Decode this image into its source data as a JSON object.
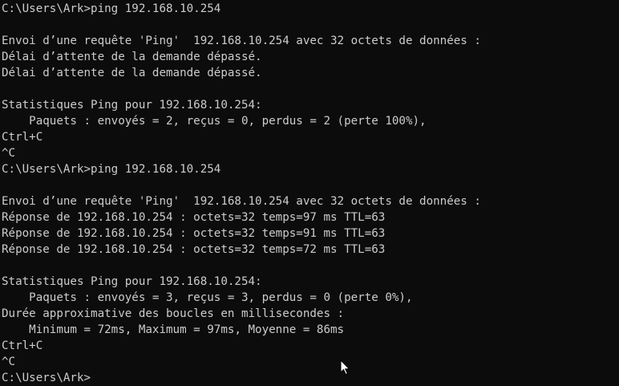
{
  "console": {
    "lines": [
      "C:\\Users\\Ark>ping 192.168.10.254",
      "",
      "Envoi d’une requête 'Ping'  192.168.10.254 avec 32 octets de données :",
      "Délai d’attente de la demande dépassé.",
      "Délai d’attente de la demande dépassé.",
      "",
      "Statistiques Ping pour 192.168.10.254:",
      "    Paquets : envoyés = 2, reçus = 0, perdus = 2 (perte 100%),",
      "Ctrl+C",
      "^C",
      "C:\\Users\\Ark>ping 192.168.10.254",
      "",
      "Envoi d’une requête 'Ping'  192.168.10.254 avec 32 octets de données :",
      "Réponse de 192.168.10.254 : octets=32 temps=97 ms TTL=63",
      "Réponse de 192.168.10.254 : octets=32 temps=91 ms TTL=63",
      "Réponse de 192.168.10.254 : octets=32 temps=72 ms TTL=63",
      "",
      "Statistiques Ping pour 192.168.10.254:",
      "    Paquets : envoyés = 3, reçus = 3, perdus = 0 (perte 0%),",
      "Durée approximative des boucles en millisecondes :",
      "    Minimum = 72ms, Maximum = 97ms, Moyenne = 86ms",
      "Ctrl+C",
      "^C",
      "C:\\Users\\Ark>"
    ]
  },
  "colors": {
    "background": "#0c0c0c",
    "text": "#cccccc"
  },
  "icons": {
    "mouse_cursor": "arrow-pointer-icon"
  }
}
